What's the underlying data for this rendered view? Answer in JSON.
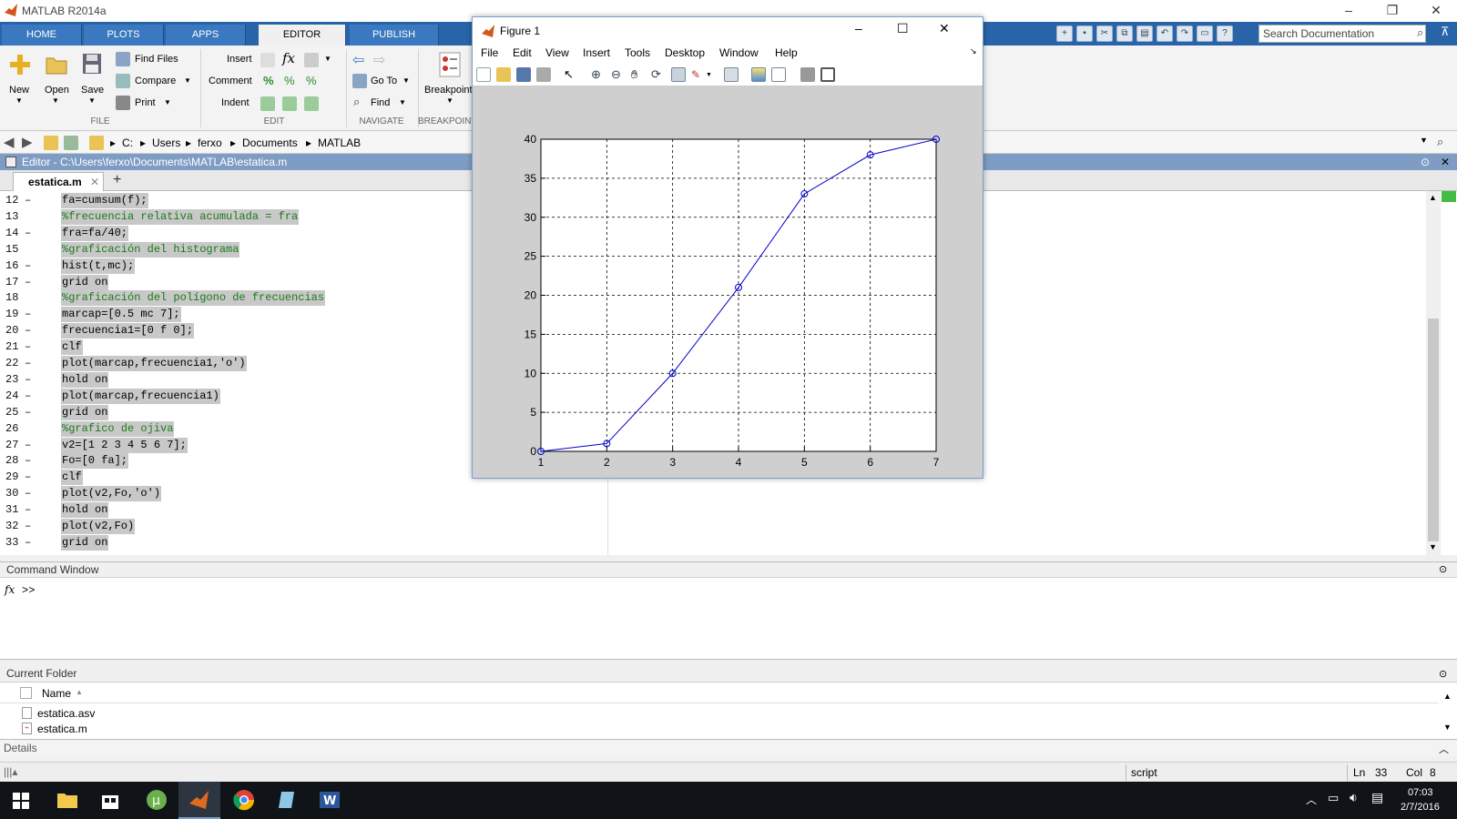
{
  "app": {
    "title": "MATLAB R2014a"
  },
  "tabs": [
    "HOME",
    "PLOTS",
    "APPS",
    "EDITOR",
    "PUBLISH"
  ],
  "search": {
    "placeholder": "Search Documentation"
  },
  "ribbon": {
    "file": {
      "new": "New",
      "open": "Open",
      "save": "Save",
      "find_files": "Find Files",
      "compare": "Compare",
      "print": "Print",
      "group": "FILE"
    },
    "edit": {
      "insert": "Insert",
      "comment": "Comment",
      "indent": "Indent",
      "group": "EDIT"
    },
    "navigate": {
      "goto": "Go To",
      "find": "Find",
      "group": "NAVIGATE"
    },
    "breakpoints": {
      "label": "Breakpoints",
      "group": "BREAKPOINTS"
    }
  },
  "breadcrumb": [
    "C:",
    "Users",
    "ferxo",
    "Documents",
    "MATLAB"
  ],
  "editor": {
    "header": "Editor - C:\\Users\\ferxo\\Documents\\MATLAB\\estatica.m",
    "tab": "estatica.m",
    "lines": [
      {
        "n": "12",
        "dash": "–",
        "code": "fa=cumsum(f);"
      },
      {
        "n": "13",
        "dash": "",
        "code": "%frecuencia relativa acumulada = fra"
      },
      {
        "n": "14",
        "dash": "–",
        "code": "fra=fa/40;"
      },
      {
        "n": "15",
        "dash": "",
        "code": "%graficación del histograma"
      },
      {
        "n": "16",
        "dash": "–",
        "code": "hist(t,mc);"
      },
      {
        "n": "17",
        "dash": "–",
        "code": "grid on"
      },
      {
        "n": "18",
        "dash": "",
        "code": "%graficación del polígono de frecuencias"
      },
      {
        "n": "19",
        "dash": "–",
        "code": "marcap=[0.5 mc 7];"
      },
      {
        "n": "20",
        "dash": "–",
        "code": "frecuencia1=[0 f 0];"
      },
      {
        "n": "21",
        "dash": "–",
        "code": "clf"
      },
      {
        "n": "22",
        "dash": "–",
        "code": "plot(marcap,frecuencia1,'o')"
      },
      {
        "n": "23",
        "dash": "–",
        "code": "hold on"
      },
      {
        "n": "24",
        "dash": "–",
        "code": "plot(marcap,frecuencia1)"
      },
      {
        "n": "25",
        "dash": "–",
        "code": "grid on"
      },
      {
        "n": "26",
        "dash": "",
        "code": "%grafico de ojiva"
      },
      {
        "n": "27",
        "dash": "–",
        "code": "v2=[1 2 3 4 5 6 7];"
      },
      {
        "n": "28",
        "dash": "–",
        "code": "Fo=[0 fa];"
      },
      {
        "n": "29",
        "dash": "–",
        "code": "clf"
      },
      {
        "n": "30",
        "dash": "–",
        "code": "plot(v2,Fo,'o')"
      },
      {
        "n": "31",
        "dash": "–",
        "code": "hold on"
      },
      {
        "n": "32",
        "dash": "–",
        "code": "plot(v2,Fo)"
      },
      {
        "n": "33",
        "dash": "–",
        "code": "grid on"
      }
    ]
  },
  "command_window": {
    "title": "Command Window",
    "fx": "fx",
    "prompt": ">>"
  },
  "current_folder": {
    "title": "Current Folder",
    "column": "Name",
    "files": [
      "estatica.asv",
      "estatica.m"
    ]
  },
  "details": {
    "title": "Details"
  },
  "status": {
    "type": "script",
    "ln_label": "Ln",
    "ln": "33",
    "col_label": "Col",
    "col": "8"
  },
  "taskbar": {
    "time": "07:03",
    "date": "2/7/2016"
  },
  "figure": {
    "title": "Figure 1",
    "menus": [
      "File",
      "Edit",
      "View",
      "Insert",
      "Tools",
      "Desktop",
      "Window",
      "Help"
    ]
  },
  "chart_data": {
    "type": "line",
    "x": [
      1,
      2,
      3,
      4,
      5,
      6,
      7
    ],
    "series": [
      {
        "values": [
          0,
          1,
          10,
          21,
          33,
          38,
          40
        ],
        "color": "#0000cc",
        "marker": "o"
      }
    ],
    "xlim": [
      1,
      7
    ],
    "ylim": [
      0,
      40
    ],
    "xticks": [
      "1",
      "2",
      "3",
      "4",
      "5",
      "6",
      "7"
    ],
    "yticks": [
      "0",
      "5",
      "10",
      "15",
      "20",
      "25",
      "30",
      "35",
      "40"
    ],
    "grid": true,
    "title": "",
    "xlabel": "",
    "ylabel": ""
  }
}
